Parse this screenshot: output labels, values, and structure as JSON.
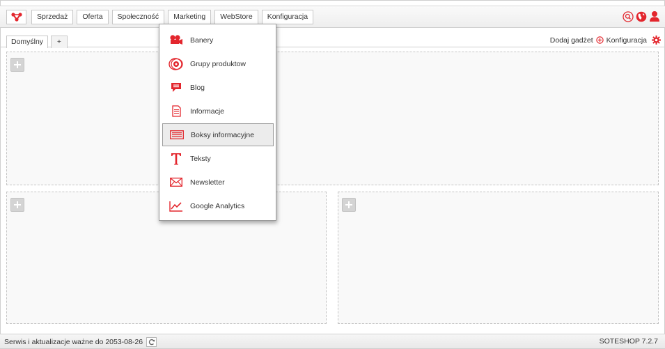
{
  "colors": {
    "accent": "#e3262d",
    "border": "#c8c8c8",
    "area_bg": "#f9f9f9"
  },
  "nav": {
    "logo_icon": "soteshop-logo-icon",
    "items": [
      {
        "label": "Sprzedaż"
      },
      {
        "label": "Oferta"
      },
      {
        "label": "Społeczność"
      },
      {
        "label": "Marketing",
        "active": true
      },
      {
        "label": "WebStore"
      },
      {
        "label": "Konfiguracja"
      }
    ]
  },
  "top_icons": [
    "search-icon",
    "globe-icon",
    "user-icon"
  ],
  "tabs": {
    "default_label": "Domyślny",
    "add_label": "+",
    "add_gadget_label": "Dodaj gadżet",
    "config_label": "Konfiguracja"
  },
  "marketing_menu": {
    "items": [
      {
        "label": "Banery",
        "icon": "banner-icon"
      },
      {
        "label": "Grupy produktow",
        "icon": "product-groups-icon"
      },
      {
        "label": "Blog",
        "icon": "blog-icon"
      },
      {
        "label": "Informacje",
        "icon": "document-icon"
      },
      {
        "label": "Boksy informacyjne",
        "icon": "info-boxes-icon",
        "selected": true
      },
      {
        "label": "Teksty",
        "icon": "text-icon"
      },
      {
        "label": "Newsletter",
        "icon": "envelope-icon"
      },
      {
        "label": "Google Analytics",
        "icon": "chart-line-icon"
      }
    ]
  },
  "footer": {
    "service_text": "Serwis i aktualizacje ważne do 2053-08-26",
    "version": "SOTESHOP 7.2.7"
  }
}
